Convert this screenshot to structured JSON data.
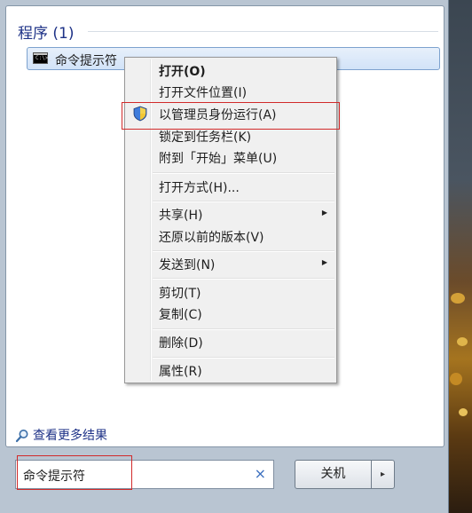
{
  "section": {
    "title": "程序 (1)"
  },
  "result": {
    "label": "命令提示符",
    "icon_text": "C:\\>_"
  },
  "context_menu": {
    "items": [
      {
        "label": "打开(O)",
        "bold": true
      },
      {
        "label": "打开文件位置(I)"
      },
      {
        "label": "以管理员身份运行(A)",
        "icon": "uac-shield-icon"
      },
      {
        "label": "锁定到任务栏(K)"
      },
      {
        "label": "附到「开始」菜单(U)"
      },
      {
        "label": "打开方式(H)..."
      },
      {
        "label": "共享(H)",
        "submenu": true
      },
      {
        "label": "还原以前的版本(V)"
      },
      {
        "label": "发送到(N)",
        "submenu": true
      },
      {
        "label": "剪切(T)"
      },
      {
        "label": "复制(C)"
      },
      {
        "label": "删除(D)"
      },
      {
        "label": "属性(R)"
      }
    ]
  },
  "more_results": {
    "label": "查看更多结果"
  },
  "search": {
    "value": "命令提示符",
    "clear_glyph": "×"
  },
  "shutdown": {
    "label": "关机",
    "arrow_glyph": "▸"
  },
  "colors": {
    "highlight_box": "#d12a2a",
    "accent_text": "#1e3287"
  }
}
